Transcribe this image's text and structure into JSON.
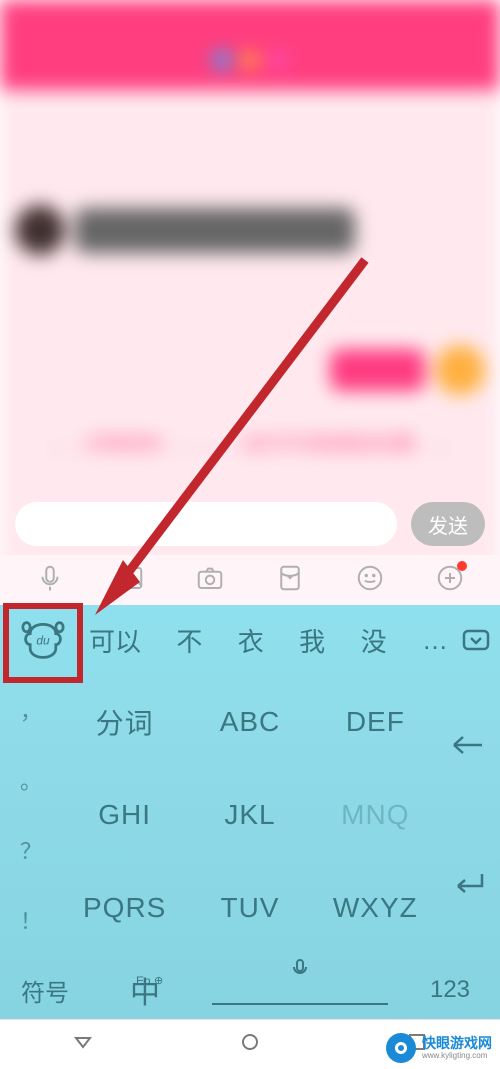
{
  "chat": {
    "sys_message": "……文档收到……   ……去打开消息推送设置……"
  },
  "input": {
    "send_label": "发送"
  },
  "keyboard": {
    "suggestions": [
      "可以",
      "不",
      "衣",
      "我",
      "没",
      "…"
    ],
    "side_punct": [
      "，",
      "。",
      "？",
      "！"
    ],
    "keys": [
      {
        "label": "分词"
      },
      {
        "label": "ABC"
      },
      {
        "label": "DEF"
      },
      {
        "label": "GHI"
      },
      {
        "label": "JKL"
      },
      {
        "label": "MNQ",
        "faded": true
      },
      {
        "label": "PQRS"
      },
      {
        "label": "TUV"
      },
      {
        "label": "WXYZ"
      }
    ],
    "symbol_label": "符号",
    "lang_main": "中",
    "lang_alt": "En",
    "lang_globe": "⊕",
    "numeric_label": "123"
  },
  "watermark": {
    "title": "快眼游戏网",
    "url": "www.kyligting.com"
  }
}
